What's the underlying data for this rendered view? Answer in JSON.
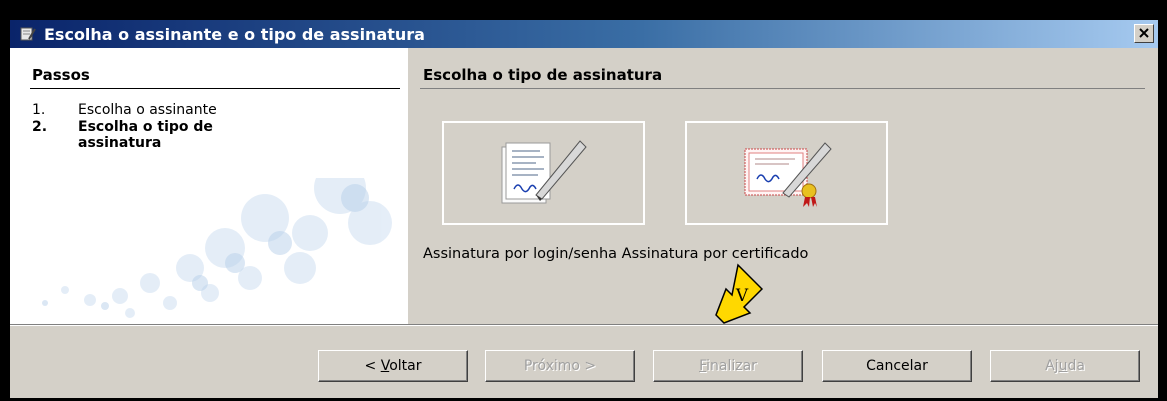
{
  "window": {
    "title": "Escolha o assinante e o tipo de assinatura",
    "close_label": "×"
  },
  "sidebar": {
    "title": "Passos",
    "steps": [
      {
        "number": "1.",
        "label": "Escolha o assinante",
        "active": false
      },
      {
        "number": "2.",
        "label": "Escolha o tipo de assinatura",
        "active": true
      }
    ]
  },
  "content": {
    "title": "Escolha o tipo de assinatura",
    "options_label": "Assinatura por login/senha Assinatura por certificado",
    "options": [
      {
        "label": "Assinatura por login/senha",
        "icon": "document-pen-icon"
      },
      {
        "label": "Assinatura por certificado",
        "icon": "certificate-pen-icon"
      }
    ]
  },
  "buttons": {
    "back": {
      "prefix": "< ",
      "mnemonic": "V",
      "rest": "oltar",
      "enabled": true
    },
    "next": {
      "label": "Próximo >",
      "enabled": false
    },
    "finish": {
      "mnemonic": "F",
      "rest": "inalizar",
      "enabled": false
    },
    "cancel": {
      "label": "Cancelar",
      "enabled": true
    },
    "help": {
      "prefix": "Aj",
      "mnemonic": "u",
      "rest": "da",
      "enabled": false
    }
  },
  "annotation": {
    "label": "V",
    "color": "#ffd800"
  }
}
